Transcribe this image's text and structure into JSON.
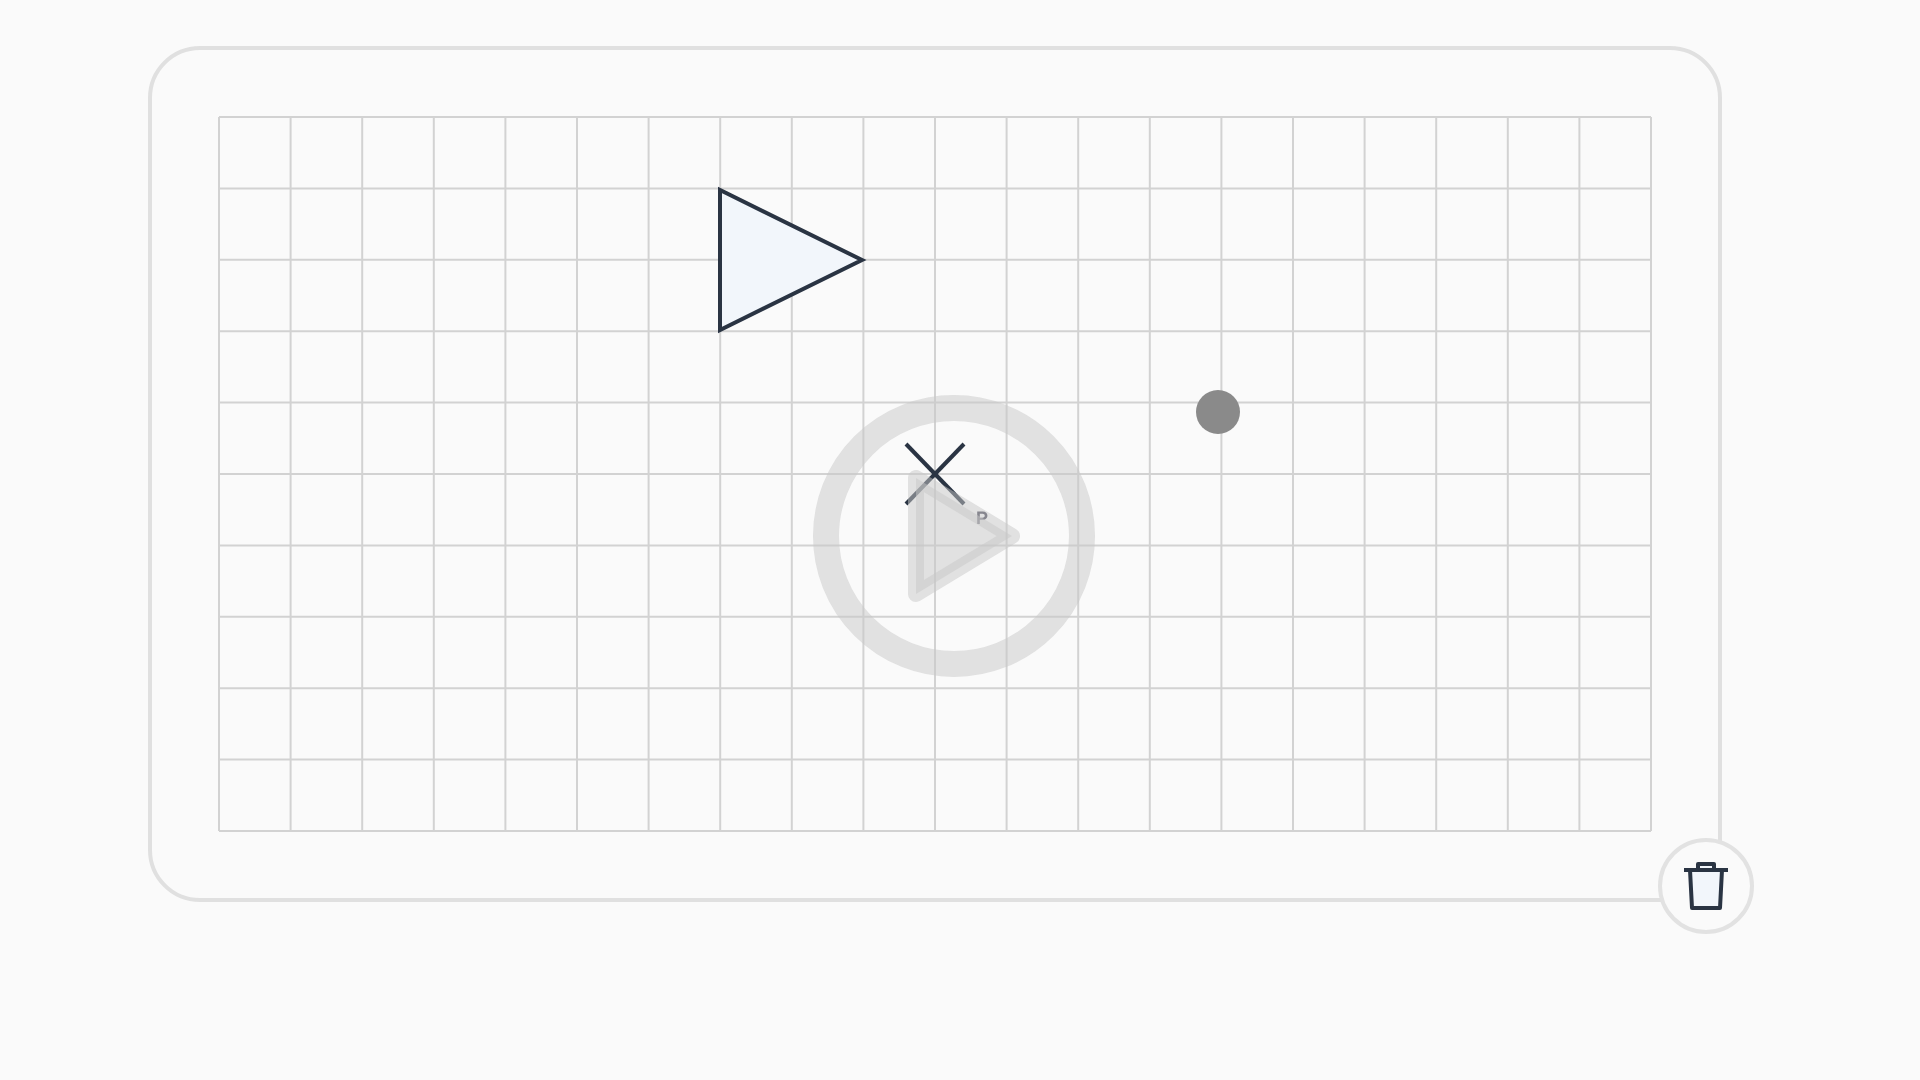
{
  "canvas": {
    "shapes": [
      {
        "kind": "triangle"
      },
      {
        "kind": "cross",
        "label": "P"
      },
      {
        "kind": "point"
      }
    ]
  }
}
